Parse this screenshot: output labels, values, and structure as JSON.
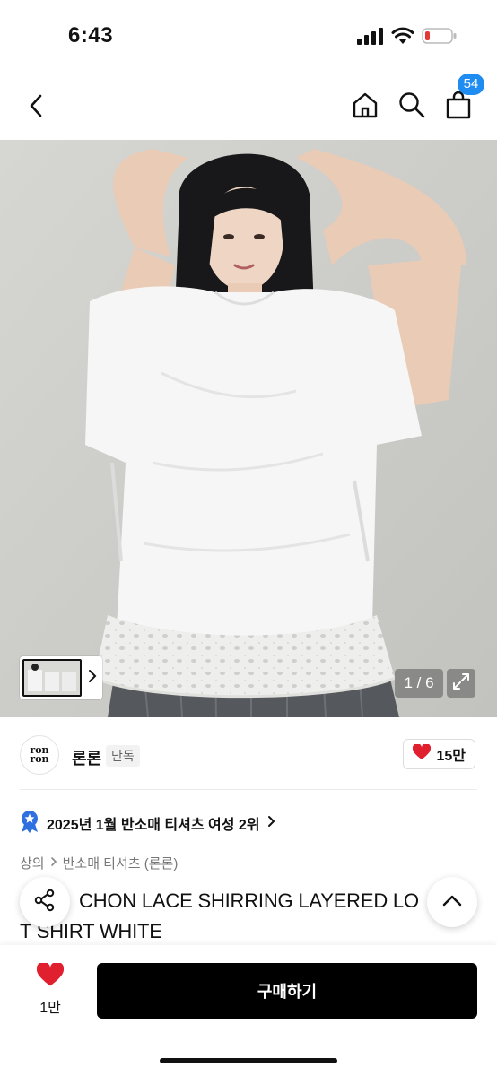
{
  "status_bar": {
    "time": "6:43"
  },
  "nav": {
    "cart_count": "54"
  },
  "hero": {
    "page_indicator": "1 / 6"
  },
  "brand": {
    "logo_text_top": "ron",
    "logo_text_bottom": "ron",
    "name": "론론",
    "tag": "단독",
    "like_count": "15만",
    "accent_color": "#e0202e"
  },
  "ranking": {
    "text": "2025년 1월 반소매 티셔츠 여성 2위"
  },
  "breadcrumb": {
    "items": [
      "상의",
      "반소매 티셔츠 (론론)"
    ]
  },
  "product": {
    "title_line1": "CHON LACE SHIRRING LAYERED LO",
    "title_line2": "T SHIRT WHITE"
  },
  "bottom_bar": {
    "like_count": "1만",
    "buy_label": "구매하기"
  }
}
